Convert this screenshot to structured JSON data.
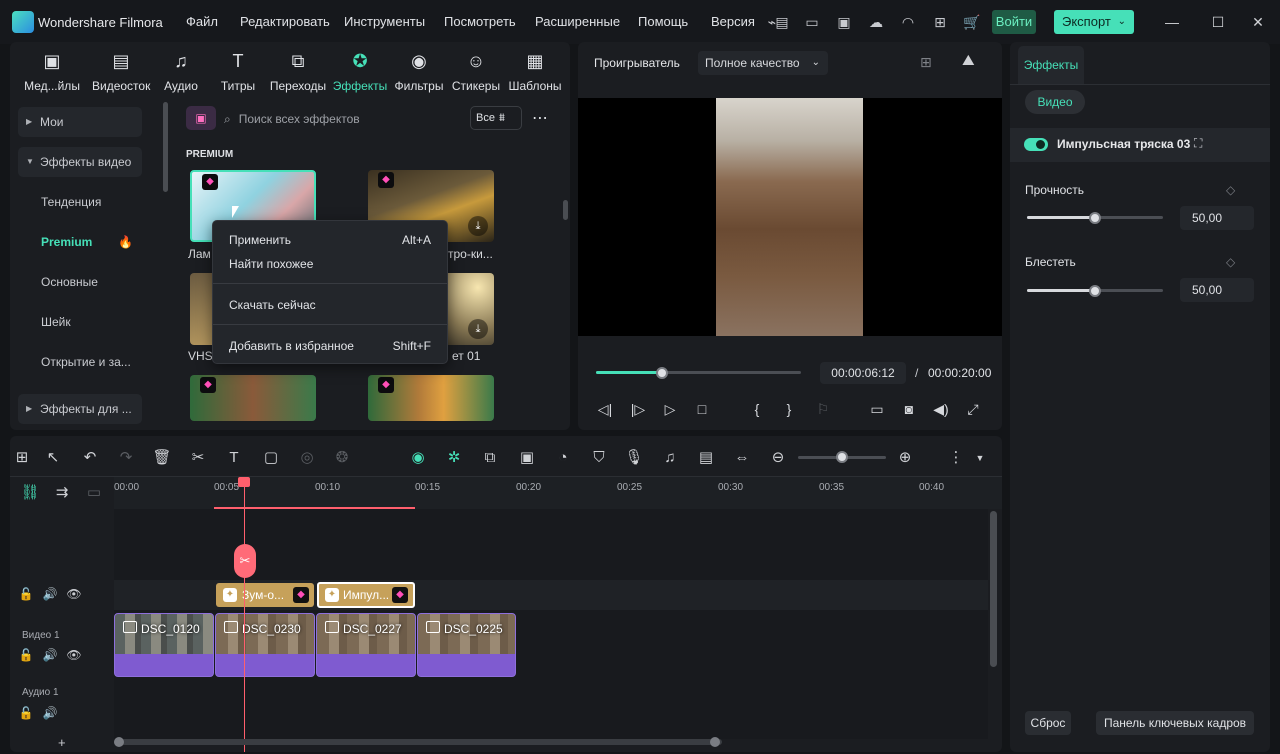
{
  "app": {
    "title": "Wondershare Filmora"
  },
  "menu": [
    "Файл",
    "Редактировать",
    "Инструменты",
    "Посмотреть",
    "Расширенные",
    "Помощь",
    "Версия"
  ],
  "header": {
    "login": "Войти",
    "export": "Экспорт"
  },
  "tabs": [
    {
      "label": "Мед...йлы",
      "icon": "media-icon"
    },
    {
      "label": "Видеосток",
      "icon": "stock-icon"
    },
    {
      "label": "Аудио",
      "icon": "music-note-icon"
    },
    {
      "label": "Титры",
      "icon": "text-icon"
    },
    {
      "label": "Переходы",
      "icon": "transition-icon"
    },
    {
      "label": "Эффекты",
      "icon": "effects-icon"
    },
    {
      "label": "Фильтры",
      "icon": "filter-icon"
    },
    {
      "label": "Стикеры",
      "icon": "sticker-icon"
    },
    {
      "label": "Шаблоны",
      "icon": "template-icon"
    }
  ],
  "sidebar": {
    "items": [
      "Мои",
      "Эффекты видео",
      "Тенденция",
      "Premium",
      "Основные",
      "Шейк",
      "Открытие и за...",
      "Эффекты для ..."
    ]
  },
  "effects": {
    "search_placeholder": "Поиск всех эффектов",
    "filter_label": "Все",
    "section": "PREMIUM",
    "items": [
      "Лам",
      "тро-ки...",
      "VHS",
      "ет 01"
    ]
  },
  "context_menu": {
    "apply": "Применить",
    "apply_shortcut": "Alt+A",
    "similar": "Найти похожее",
    "download": "Скачать сейчас",
    "favorite": "Добавить в избранное",
    "favorite_shortcut": "Shift+F"
  },
  "player": {
    "label": "Проигрыватель",
    "quality": "Полное качество",
    "current_time": "00:00:06:12",
    "separator": "/",
    "total_time": "00:00:20:00",
    "progress": 0.32
  },
  "right_panel": {
    "tab": "Эффекты",
    "subtab": "Видео",
    "effect_name": "Импульсная тряска 03",
    "params": [
      {
        "label": "Прочность",
        "value": "50,00",
        "level": 0.5
      },
      {
        "label": "Блестеть",
        "value": "50,00",
        "level": 0.5
      }
    ],
    "reset": "Сброс",
    "keyframes": "Панель ключевых кадров"
  },
  "timeline": {
    "ruler": [
      "00:00",
      "00:05",
      "00:10",
      "00:15",
      "00:20",
      "00:25",
      "00:30",
      "00:35",
      "00:40"
    ],
    "fx_clips": [
      "Зум-о...",
      "Импул..."
    ],
    "video_track": "Видео 1",
    "audio_track": "Аудио 1",
    "clips": [
      "DSC_0120",
      "DSC_0230",
      "DSC_0227",
      "DSC_0225"
    ],
    "add": "+"
  },
  "colors": {
    "accent": "#46e0b8",
    "playhead": "#ff5f6d",
    "clip": "#7f5bd0",
    "fx": "#c6a15a"
  }
}
